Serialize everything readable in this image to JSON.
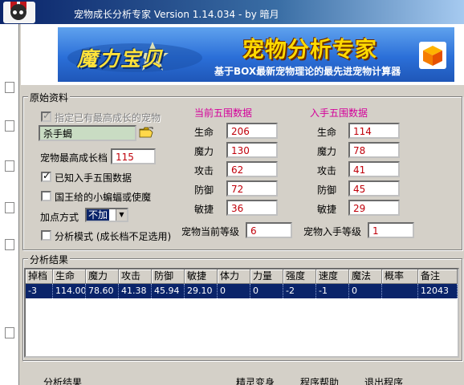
{
  "window": {
    "title": "宠物成长分析专家 Version 1.14.034 - by 暗月"
  },
  "banner": {
    "brand": "魔力宝贝",
    "title": "宠物分析专家",
    "subtitle": "基于BOX最新宠物理论的最先进宠物计算器"
  },
  "raw": {
    "group_label": "原始资料",
    "specify_label": "指定已有最高成长的宠物",
    "pet_name": "杀手蝎",
    "max_growth_label": "宠物最高成长档",
    "max_growth_value": "115",
    "known_stats_label": "已知入手五围数据",
    "bat_label": "国王给的小蝙蝠或使魔",
    "add_mode_label": "加点方式",
    "add_mode_value": "不加",
    "analysis_mode_label": "分析模式 (成长档不足选用)",
    "current_header": "当前五围数据",
    "acquire_header": "入手五围数据",
    "stat_labels": [
      "生命",
      "魔力",
      "攻击",
      "防御",
      "敏捷"
    ],
    "current_values": [
      "206",
      "130",
      "62",
      "72",
      "36"
    ],
    "acquire_values": [
      "114",
      "78",
      "41",
      "45",
      "29"
    ],
    "current_level_label": "宠物当前等级",
    "current_level": "6",
    "acquire_level_label": "宠物入手等级",
    "acquire_level": "1"
  },
  "results": {
    "group_label": "分析结果",
    "columns": [
      "掉档",
      "生命",
      "魔力",
      "攻击",
      "防御",
      "敏捷",
      "体力",
      "力量",
      "强度",
      "速度",
      "魔法",
      "概率",
      "备注"
    ],
    "rows": [
      [
        "-3",
        "114.00",
        "78.60",
        "41.38",
        "45.94",
        "29.10",
        "0",
        "0",
        "-2",
        "-1",
        "0",
        "",
        "12043"
      ]
    ]
  },
  "footer": {
    "items": [
      "分析结果",
      "精灵变身",
      "程序帮助",
      "退出程序"
    ]
  }
}
